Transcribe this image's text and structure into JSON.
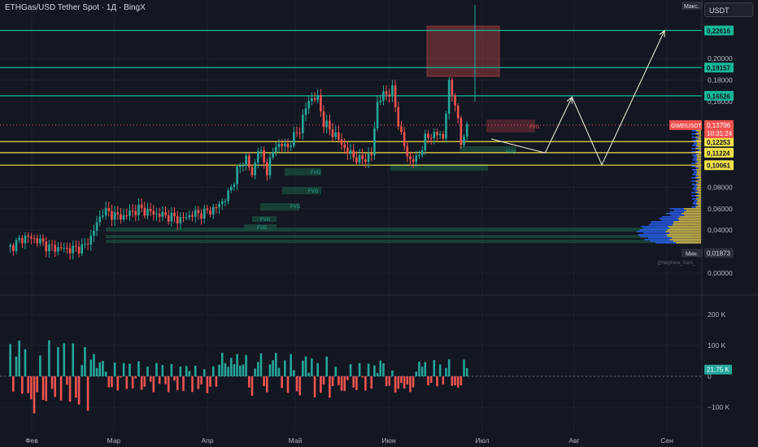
{
  "header": {
    "title": "ETHGas/USD Tether Spot · 1Д · BingX"
  },
  "currency_selector": {
    "value": "USDT"
  },
  "watermark": "@Nephew_Sam_",
  "colors": {
    "background": "#131722",
    "up": "#26a69a",
    "down": "#ef5350",
    "cyan_line": "#17b79a",
    "yellow_line": "#f0e04a",
    "fvg_up": "#1b4d3e",
    "fvg_down": "#5e2a33",
    "vp_blue": "#2962ff",
    "vp_yellow": "#e6c229"
  },
  "chart_data": [
    {
      "type": "candlestick",
      "title": "ETHGas/USD Tether Spot · 1Д · BingX",
      "symbol": "GWEIUSDT",
      "interval": "1Д",
      "y_ticks": [
        "0,20000",
        "0,18000",
        "0,16000",
        "0,08000",
        "0,06000",
        "0,04000",
        "0,00000"
      ],
      "x_ticks": [
        "Фев",
        "Мар",
        "Апр",
        "Май",
        "Июн",
        "Июл",
        "Авг",
        "Сен"
      ],
      "ylim": [
        0,
        0.25
      ],
      "level_lines": [
        {
          "value": 0.22616,
          "label": "0,22616",
          "color": "cyan"
        },
        {
          "value": 0.19157,
          "label": "0,19157",
          "color": "cyan"
        },
        {
          "value": 0.16526,
          "label": "0,16526",
          "color": "cyan"
        },
        {
          "value": 0.12253,
          "label": "0,12253",
          "color": "yellow"
        },
        {
          "value": 0.11224,
          "label": "0,11224",
          "color": "yellow"
        },
        {
          "value": 0.10061,
          "label": "0,10061",
          "color": "yellow"
        }
      ],
      "max_label": "Макс.",
      "min_label": "Мин.",
      "min_value": "0,01873",
      "current_price": {
        "symbol": "GWEIUSDT",
        "value": "0,13796",
        "countdown": "10:31:24"
      },
      "annotations": [
        "FVG",
        "FVG",
        "FVG",
        "FVG",
        "FVG",
        "FVG",
        "FVG"
      ],
      "projection_path": [
        {
          "date": "Jul 05",
          "value": 0.125
        },
        {
          "date": "Jul 23",
          "value": 0.112
        },
        {
          "date": "Aug 01",
          "value": 0.164
        },
        {
          "date": "Aug 11",
          "value": 0.101
        },
        {
          "date": "Sep 01",
          "value": 0.226
        }
      ]
    },
    {
      "type": "bar",
      "title": "",
      "y_ticks": [
        "200 K",
        "100 K",
        "0",
        "−100 K"
      ],
      "current_value_label": "21,75 K",
      "ylim": [
        -180000,
        215000
      ]
    }
  ]
}
